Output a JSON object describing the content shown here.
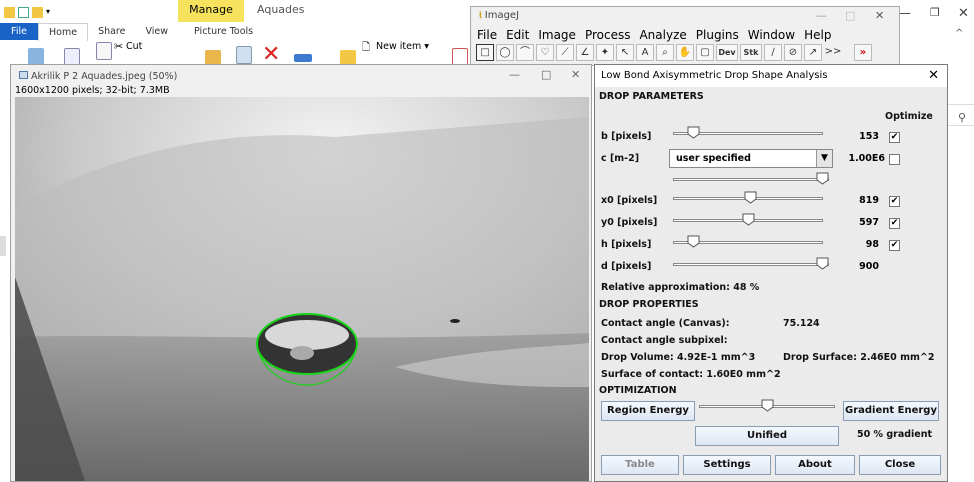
{
  "explorer": {
    "manage_tab": "Manage",
    "app_title": "Aquades",
    "tabs": [
      "File",
      "Home",
      "Share",
      "View",
      "Picture Tools"
    ],
    "ribbon": {
      "cut": "Cut",
      "new_item": "New item ▾"
    }
  },
  "imagej": {
    "title": "ImageJ",
    "menu": [
      "File",
      "Edit",
      "Image",
      "Process",
      "Analyze",
      "Plugins",
      "Window",
      "Help"
    ],
    "tools": [
      "□",
      "◯",
      "⌒",
      "♡",
      "⟋",
      "∠",
      "✦",
      "↖",
      "A",
      "⌕",
      "✋",
      "▢",
      "Dev",
      "Stk",
      "∕",
      "⊘",
      "↗",
      ">>"
    ]
  },
  "image_window": {
    "title": "Akrilik P 2 Aquades.jpeg (50%)",
    "info": "1600x1200 pixels; 32-bit; 7.3MB"
  },
  "drop_panel": {
    "title": "Low Bond Axisymmetric Drop Shape Analysis",
    "section_params": "DROP PARAMETERS",
    "optimize_label": "Optimize",
    "params": [
      {
        "label": "b [pixels]",
        "value": "153",
        "checked": true,
        "slider": 0.1
      },
      {
        "label": "x0 [pixels]",
        "value": "819",
        "checked": true,
        "slider": 0.52
      },
      {
        "label": "y0 [pixels]",
        "value": "597",
        "checked": true,
        "slider": 0.5
      },
      {
        "label": "h [pixels]",
        "value": "98",
        "checked": true,
        "slider": 0.1
      },
      {
        "label": "d [pixels]",
        "value": "900",
        "checked": false,
        "slider": 1.0
      }
    ],
    "c_param": {
      "label": "c [m-2]",
      "select_value": "user specified",
      "value": "1.00E6",
      "checked": false,
      "slider": 1.0
    },
    "relative": "Relative approximation: 48 %",
    "section_props": "DROP PROPERTIES",
    "contact_angle_label": "Contact angle (Canvas):",
    "contact_angle_value": "75.124",
    "contact_subpixel": "Contact angle subpixel:",
    "drop_volume": "Drop Volume: 4.92E-1 mm^3",
    "drop_surface": "Drop Surface: 2.46E0 mm^2",
    "surface_contact": "Surface of contact: 1.60E0 mm^2",
    "section_opt": "OPTIMIZATION",
    "region_energy": "Region Energy",
    "gradient_energy": "Gradient Energy",
    "opt_slider": 0.5,
    "unified": "Unified",
    "gradient_pct": "50 % gradient",
    "buttons": {
      "table": "Table",
      "settings": "Settings",
      "about": "About",
      "close": "Close"
    }
  }
}
